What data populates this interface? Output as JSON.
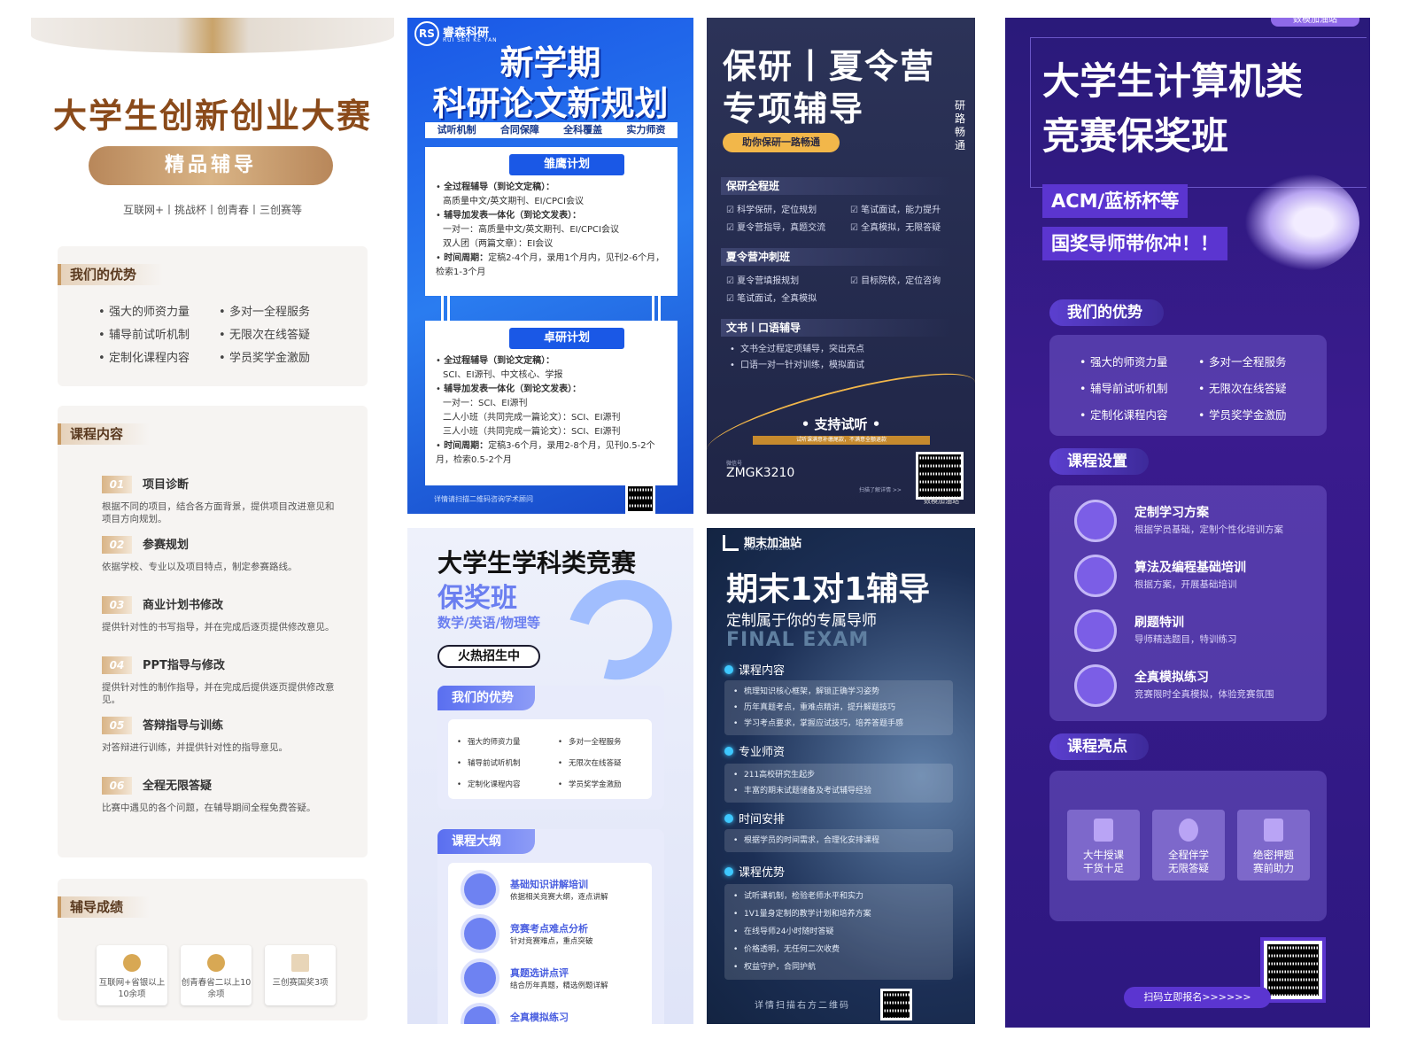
{
  "p1": {
    "title": "大学生创新创业大赛",
    "badge": "精品辅导",
    "subtitle": "互联网+丨挑战杯丨创青春丨三创赛等",
    "adv_title": "我们的优势",
    "adv_left": [
      "强大的师资力量",
      "辅导前试听机制",
      "定制化课程内容"
    ],
    "adv_right": [
      "多对一全程服务",
      "无限次在线答疑",
      "学员奖学金激励"
    ],
    "course_title": "课程内容",
    "items": [
      {
        "num": "01",
        "title": "项目诊断",
        "desc": "根据不同的项目，结合各方面背景，提供项目改进意见和项目方向规划。"
      },
      {
        "num": "02",
        "title": "参赛规划",
        "desc": "依据学校、专业以及项目特点，制定参赛路线。"
      },
      {
        "num": "03",
        "title": "商业计划书修改",
        "desc": "提供针对性的书写指导，并在完成后逐页提供修改意见。"
      },
      {
        "num": "04",
        "title": "PPT指导与修改",
        "desc": "提供针对性的制作指导，并在完成后提供逐页提供修改意见。"
      },
      {
        "num": "05",
        "title": "答辩指导与训练",
        "desc": "对答辩进行训练，并提供针对性的指导意见。"
      },
      {
        "num": "06",
        "title": "全程无限答疑",
        "desc": "比赛中遇见的各个问题，在辅导期间全程免费答疑。"
      }
    ],
    "result_title": "辅导成绩",
    "results": [
      "互联网+省银以上10余项",
      "创青春省二以上10余项",
      "三创赛国奖3项"
    ]
  },
  "p2": {
    "logo": "RS",
    "brand": "睿森科研",
    "brand_en": "RUI SEN KE YAN",
    "title1": "新学期",
    "title2": "科研论文新规划",
    "features": [
      "试听机制",
      "合同保障",
      "全科覆盖",
      "实力师资"
    ],
    "plan1": {
      "name": "雏鹰计划",
      "l1": "全过程辅导（到论文定稿）：",
      "l1b": "高质量中文/英文期刊、EI/CPCI会议",
      "l2": "辅导加发表一体化（到论文发表）：",
      "l2b": "一对一：高质量中文/英文期刊、EI/CPCI会议",
      "l2c": "双人团（两篇文章）：EI会议",
      "l3": "时间周期：",
      "l3b": "定稿2-4个月，录用1个月内，见刊2-6个月，检索1-3个月"
    },
    "plan2": {
      "name": "卓研计划",
      "l1": "全过程辅导（到论文定稿）：",
      "l1b": "SCI、EI源刊、中文核心、学报",
      "l2": "辅导加发表一体化（到论文发表）：",
      "l2b": "一对一：SCI、EI源刊",
      "l2c": "二人小班（共同完成一篇论文）：SCI、EI源刊",
      "l2d": "三人小班（共同完成一篇论文）：SCI、EI源刊",
      "l3": "时间周期：",
      "l3b": "定稿3-6个月，录用2-8个月，见刊0.5-2个月，检索0.5-2个月"
    },
    "footer": "详情请扫描二维码咨询学术顾问"
  },
  "p3": {
    "title1": "保研丨夏令营",
    "title2": "专项辅导",
    "side": "研路畅通",
    "pill": "助你保研一路畅通",
    "s1": "保研全程班",
    "s1_items": [
      "科学保研，定位规划",
      "笔试面试，能力提升",
      "夏令营指导，真题交流",
      "全真模拟，无限答疑"
    ],
    "s2": "夏令营冲刺班",
    "s2_items": [
      "夏令营填报规划",
      "目标院校，定位咨询",
      "笔试面试，全真模拟"
    ],
    "s3": "文书丨口语辅导",
    "s3_items": [
      "文书全过程定项辅导，突出亮点",
      "口语一对一针对训练，模拟面试"
    ],
    "support": "• 支持试听 •",
    "support_note": "试听课满意补缴尾款，不满意全额退款",
    "wechat_label": "微信号",
    "wechat_id": "ZMGK3210",
    "scan": "扫描了解详情 >>",
    "watermark": "数模加油站"
  },
  "p4": {
    "title": "大学生学科类竞赛",
    "title2": "保奖班",
    "subjects": "数学/英语/物理等",
    "pill": "火热招生中",
    "adv_title": "我们的优势",
    "adv_left": [
      "强大的师资力量",
      "辅导前试听机制",
      "定制化课程内容"
    ],
    "adv_right": [
      "多对一全程服务",
      "无限次在线答疑",
      "学员奖学金激励"
    ],
    "course_title": "课程大纲",
    "courses": [
      {
        "a": "基础知识讲解培训",
        "b": "依据相关竞赛大纲，逐点讲解"
      },
      {
        "a": "竞赛考点难点分析",
        "b": "针对竞赛难点，重点突破"
      },
      {
        "a": "真题选讲点评",
        "b": "结合历年真题，精选例题详解"
      },
      {
        "a": "全真模拟练习",
        "b": ""
      }
    ]
  },
  "p5": {
    "brand": "期末加油站",
    "brand_en": "QIMOJIAYOUZHAN",
    "title": "期末1对1辅导",
    "sub": "定制属于你的专属导师",
    "en": "FINAL EXAM",
    "s1": "课程内容",
    "s1_items": [
      "梳理知识核心框架，解锁正确学习姿势",
      "历年真题考点，重难点精讲，提升解题技巧",
      "学习考点要求，掌握应试技巧，培养答题手感"
    ],
    "s2": "专业师资",
    "s2_items": [
      "211高校研究生起步",
      "丰富的期末试题储备及考试辅导经验"
    ],
    "s3": "时间安排",
    "s3_items": [
      "根据学员的时间需求，合理化安排课程"
    ],
    "s4": "课程优势",
    "s4_items": [
      "试听课机制，检验老师水平和实力",
      "1V1量身定制的教学计划和培养方案",
      "在线导师24小时随时答疑",
      "价格透明，无任何二次收费",
      "权益守护，合同护航"
    ],
    "footer": "详情扫描右方二维码"
  },
  "p6": {
    "tag": "数模加油站",
    "title1": "大学生计算机类",
    "title2": "竞赛保奖班",
    "label1": "ACM/蓝桥杯等",
    "label2": "国奖导师带你冲！！",
    "adv_title": "我们的优势",
    "adv_left": [
      "强大的师资力量",
      "辅导前试听机制",
      "定制化课程内容"
    ],
    "adv_right": [
      "多对一全程服务",
      "无限次在线答疑",
      "学员奖学金激励"
    ],
    "course_title": "课程设置",
    "courses": [
      {
        "a": "定制学习方案",
        "b": "根据学员基础，定制个性化培训方案"
      },
      {
        "a": "算法及编程基础培训",
        "b": "根据方案，开展基础培训"
      },
      {
        "a": "刷题特训",
        "b": "导师精选题目，特训练习"
      },
      {
        "a": "全真模拟练习",
        "b": "竞赛限时全真模拟，体验竞赛氛围"
      }
    ],
    "hl_title": "课程亮点",
    "highlights": [
      {
        "a": "大牛授课",
        "b": "干货十足"
      },
      {
        "a": "全程伴学",
        "b": "无限答疑"
      },
      {
        "a": "绝密押题",
        "b": "赛前助力"
      }
    ],
    "scan": "扫码立即报名>>>>>>"
  }
}
